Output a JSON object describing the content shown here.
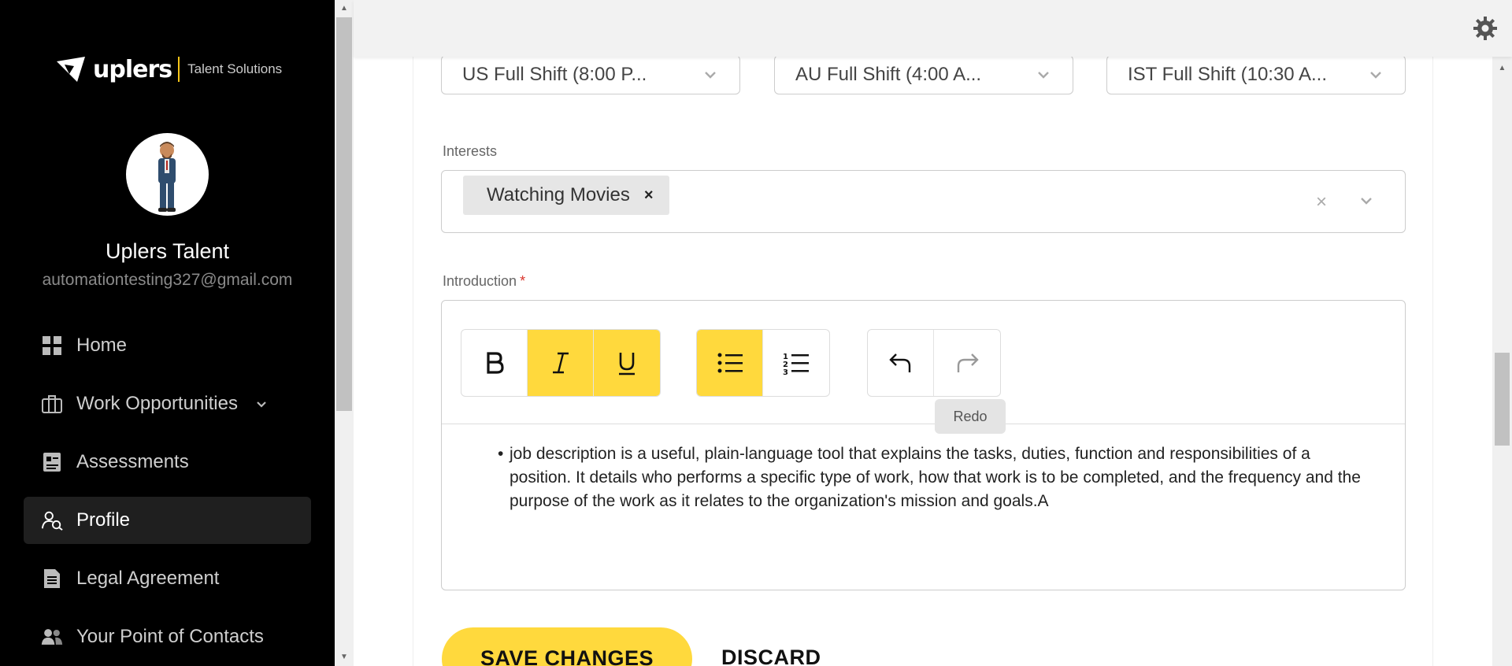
{
  "sidebar": {
    "brand": {
      "name": "uplers",
      "subtitle": "Talent Solutions"
    },
    "user": {
      "name": "Uplers Talent",
      "email": "automationtesting327@gmail.com"
    },
    "nav": [
      {
        "label": "Home",
        "icon": "grid-icon"
      },
      {
        "label": "Work Opportunities",
        "icon": "briefcase-icon",
        "expandable": true
      },
      {
        "label": "Assessments",
        "icon": "assessment-icon"
      },
      {
        "label": "Profile",
        "icon": "profile-search-icon",
        "active": true
      },
      {
        "label": "Legal Agreement",
        "icon": "document-icon"
      },
      {
        "label": "Your Point of Contacts",
        "icon": "contacts-icon"
      }
    ]
  },
  "shifts": [
    {
      "value": "US Full Shift (8:00 P..."
    },
    {
      "value": "AU Full Shift (4:00 A..."
    },
    {
      "value": "IST Full Shift (10:30 A..."
    }
  ],
  "interests": {
    "label": "Interests",
    "chips": [
      "Watching Movies"
    ],
    "clear_symbol": "×",
    "chip_remove_symbol": "×"
  },
  "introduction": {
    "label": "Introduction",
    "required_mark": "*",
    "toolbar": {
      "bold": {
        "label": "B",
        "active": false
      },
      "italic": {
        "label": "I",
        "active": true
      },
      "underline": {
        "label": "U",
        "active": true
      },
      "bullet_list": {
        "active": true
      },
      "numbered_list": {
        "active": false
      },
      "undo": {
        "enabled": true
      },
      "redo": {
        "enabled": false
      }
    },
    "tooltip": "Redo",
    "bullet": "•",
    "text": "job description is a useful, plain-language tool that explains the tasks, duties, function and responsibilities of a position. It details who performs a specific type of work, how that work is to be completed, and the frequency and the purpose of the work as it relates to the organization's mission and goals.A"
  },
  "actions": {
    "save": "SAVE CHANGES",
    "discard": "DISCARD"
  },
  "colors": {
    "accent": "#ffd93d",
    "sidebar_bg": "#000000",
    "active_nav": "#1f1f1f",
    "required": "#d9342b"
  }
}
